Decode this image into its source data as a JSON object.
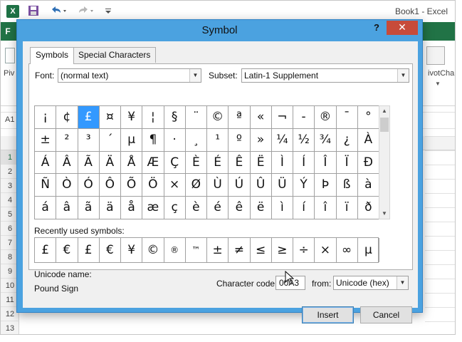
{
  "excel": {
    "logo": "X",
    "window_title": "Book1 - Excel",
    "file_tab": "F",
    "pivot_left_label": "Piv",
    "pivot_right_label": "ivotChar",
    "name_box": "A1",
    "row_numbers": [
      "1",
      "2",
      "3",
      "4",
      "5",
      "6",
      "7",
      "8",
      "9",
      "10",
      "11",
      "12",
      "13"
    ]
  },
  "dialog": {
    "title": "Symbol",
    "help": "?",
    "close": "✕",
    "tabs": [
      "Symbols",
      "Special Characters"
    ],
    "font_label": "Font:",
    "font_value": "(normal text)",
    "subset_label": "Subset:",
    "subset_value": "Latin-1 Supplement",
    "symbols": [
      [
        "¡",
        "¢",
        "£",
        "¤",
        "¥",
        "¦",
        "§",
        "¨",
        "©",
        "ª",
        "«",
        "¬",
        "-",
        "®",
        "¯",
        "°"
      ],
      [
        "±",
        "²",
        "³",
        "´",
        "µ",
        "¶",
        "·",
        "¸",
        "¹",
        "º",
        "»",
        "¼",
        "½",
        "¾",
        "¿",
        "À"
      ],
      [
        "Á",
        "Â",
        "Ã",
        "Ä",
        "Å",
        "Æ",
        "Ç",
        "È",
        "É",
        "Ê",
        "Ë",
        "Ì",
        "Í",
        "Î",
        "Ï",
        "Ð"
      ],
      [
        "Ñ",
        "Ò",
        "Ó",
        "Ô",
        "Õ",
        "Ö",
        "×",
        "Ø",
        "Ù",
        "Ú",
        "Û",
        "Ü",
        "Ý",
        "Þ",
        "ß",
        "à"
      ],
      [
        "á",
        "â",
        "ã",
        "ä",
        "å",
        "æ",
        "ç",
        "è",
        "é",
        "ê",
        "ë",
        "ì",
        "í",
        "î",
        "ï",
        "ð"
      ]
    ],
    "selected_symbol": "£",
    "recent_label": "Recently used symbols:",
    "recent_symbols": [
      "£",
      "€",
      "£",
      "€",
      "¥",
      "©",
      "®",
      "™",
      "±",
      "≠",
      "≤",
      "≥",
      "÷",
      "×",
      "∞",
      "µ"
    ],
    "unicode_name_label": "Unicode name:",
    "unicode_name_value": "Pound Sign",
    "char_code_label": "Character code:",
    "char_code_value": "00A3",
    "from_label": "from:",
    "from_value": "Unicode (hex)",
    "insert_label": "Insert",
    "cancel_label": "Cancel"
  },
  "colors": {
    "excel_green": "#217346",
    "dialog_frame": "#4ba2e0",
    "close_red": "#c74b3a",
    "selection_blue": "#3399ff"
  }
}
